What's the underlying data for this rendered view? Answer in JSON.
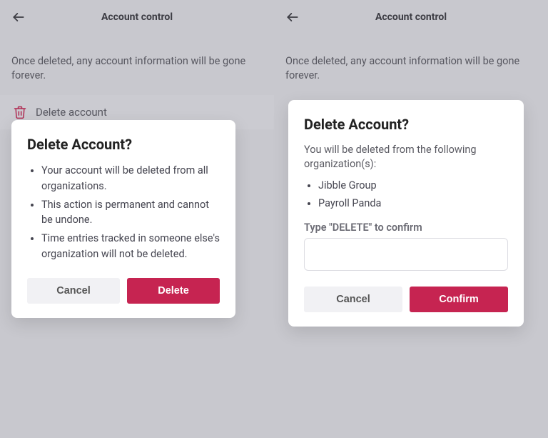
{
  "colors": {
    "accent": "#C62451",
    "scrim": "rgba(80,80,90,0.18)"
  },
  "left": {
    "header_title": "Account control",
    "info_text": "Once deleted, any account information will be gone forever.",
    "delete_row_label": "Delete account",
    "dialog": {
      "title": "Delete Account?",
      "bullets": [
        "Your account will be deleted from all organizations.",
        "This action is permanent and cannot be undone.",
        "Time entries tracked in someone else's organization will not be deleted."
      ],
      "cancel_label": "Cancel",
      "primary_label": "Delete"
    }
  },
  "right": {
    "header_title": "Account control",
    "info_text": "Once deleted, any account information will be gone forever.",
    "dialog": {
      "title": "Delete Account?",
      "lead": "You will be deleted from the following organization(s):",
      "orgs": [
        "Jibble Group",
        "Payroll Panda"
      ],
      "confirm_label": "Type \"DELETE\" to confirm",
      "confirm_value": "",
      "cancel_label": "Cancel",
      "primary_label": "Confirm"
    }
  }
}
